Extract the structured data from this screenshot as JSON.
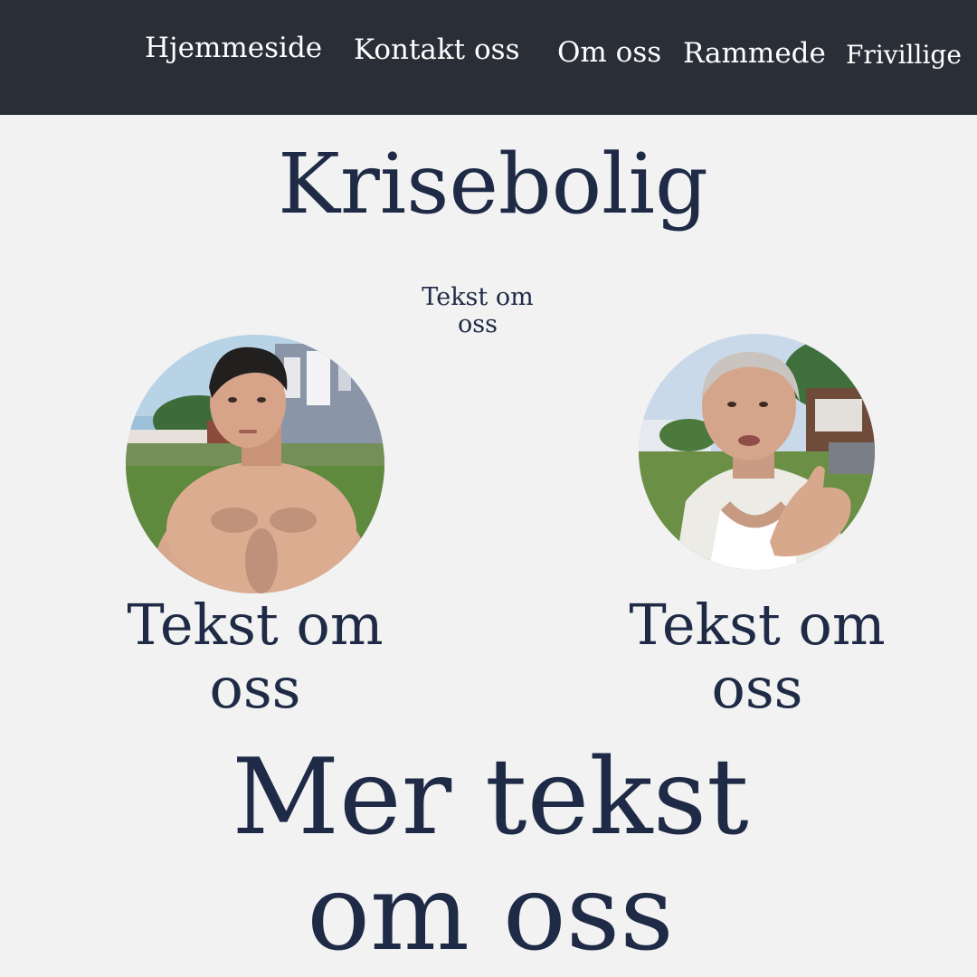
{
  "nav": {
    "items": [
      {
        "label": "Hjemmeside"
      },
      {
        "label": "Kontakt oss"
      },
      {
        "label": "Om oss"
      },
      {
        "label": "Rammede"
      },
      {
        "label": "Frivillige"
      }
    ]
  },
  "page": {
    "title": "Krisebolig",
    "intro": "Tekst om oss"
  },
  "profiles": [
    {
      "caption": "Tekst om oss",
      "photo_icon": "person-photo"
    },
    {
      "caption": "Tekst om oss",
      "photo_icon": "person-photo"
    }
  ],
  "footer": {
    "text": "Mer tekst om oss"
  },
  "colors": {
    "nav_background": "#292e37",
    "page_background": "#f2f2f2",
    "text_primary": "#1f2b46",
    "nav_text": "#ffffff"
  }
}
